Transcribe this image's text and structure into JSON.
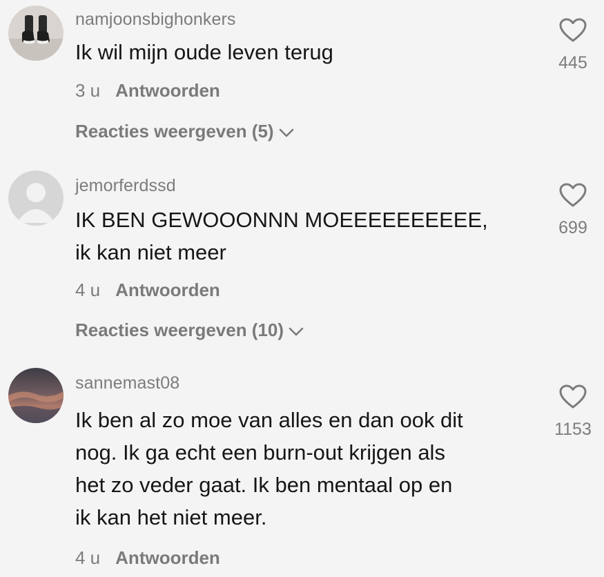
{
  "comments": [
    {
      "username": "namjoonsbighonkers",
      "lines": [
        "Ik wil mijn oude leven terug"
      ],
      "time": "3 u",
      "reply_label": "Antwoorden",
      "replies_label": "Reacties weergeven (5)",
      "likes": "445",
      "avatar_icon": "sneakers-photo"
    },
    {
      "username": "jemorferdssd",
      "lines": [
        "IK BEN GEWOOONNN MOEEEEEEEEEE,",
        "ik kan niet meer"
      ],
      "time": "4 u",
      "reply_label": "Antwoorden",
      "replies_label": "Reacties weergeven (10)",
      "likes": "699",
      "avatar_icon": "default-user-icon"
    },
    {
      "username": "sannemast08",
      "lines": [
        "Ik ben al zo moe van alles en dan ook dit",
        "nog. Ik ga echt een burn-out krijgen als",
        "het zo veder gaat. Ik ben mentaal op en",
        "ik kan het niet meer."
      ],
      "time": "4 u",
      "reply_label": "Antwoorden",
      "likes": "1153",
      "avatar_icon": "sunset-photo"
    }
  ],
  "colors": {
    "background": "#f4f4f4",
    "primary_text": "#161616",
    "secondary_text": "#7c7c7c"
  }
}
